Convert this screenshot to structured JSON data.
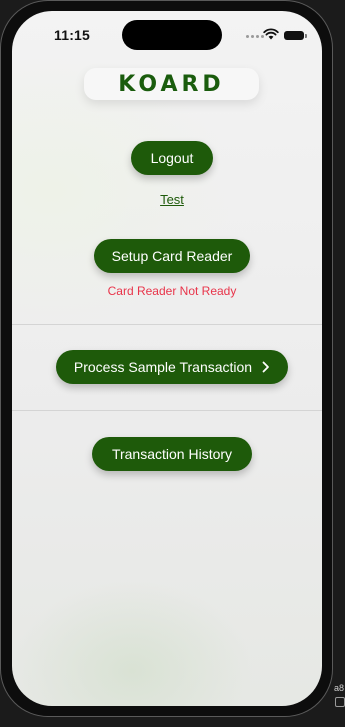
{
  "status_bar": {
    "time": "11:15"
  },
  "header": {
    "logo_text": "KOARD"
  },
  "main": {
    "logout_label": "Logout",
    "test_link_label": "Test",
    "setup_reader_label": "Setup Card Reader",
    "reader_status": "Card Reader Not Ready",
    "process_transaction_label": "Process Sample Transaction",
    "history_label": "Transaction History"
  },
  "edge": {
    "partial_text": "a8"
  },
  "colors": {
    "brand_green": "#1e5a0a",
    "logo_green": "#1a5c0d",
    "error_red": "#e8344a"
  },
  "icons": {
    "process_chevron": "chevron-right-icon",
    "wifi": "wifi-icon",
    "battery": "battery-icon"
  }
}
